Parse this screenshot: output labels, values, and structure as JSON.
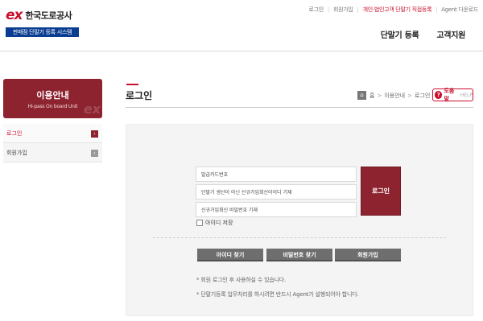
{
  "header": {
    "logo_ex": "ex",
    "logo_name": "한국도로공사",
    "system_badge": "판매점 단말기 등록 시스템",
    "top_links": [
      "로그인",
      "회원가입",
      "개인·법인고객 단말기 직접등록",
      "Agent 다운로드"
    ],
    "main_nav": [
      "단말기 등록",
      "고객지원"
    ]
  },
  "sidebar": {
    "title": "이용안내",
    "subtitle": "Hi-pass On board Unit",
    "items": [
      {
        "label": "로그인",
        "active": true
      },
      {
        "label": "회원가입",
        "active": false
      }
    ]
  },
  "content": {
    "title": "로그인",
    "breadcrumb": [
      "홈",
      "이용안내",
      "로그인"
    ],
    "help_label": "도움말",
    "help_sub": "HELP"
  },
  "login": {
    "fields": [
      "발급카드번호",
      "단말기 생산이 아닌 신규가입희신아이디 기재",
      "신규가입회신 비밀번호 기재"
    ],
    "login_button": "로그인",
    "save_id": "아이디 저장",
    "buttons": [
      "아이디 찾기",
      "비밀번호 찾기",
      "회원가입"
    ],
    "notes": [
      "*  회원 로그인 후 사용하실 수 있습니다.",
      "*  단말기등록 업무처리를 하시려면 반드시 Agent가 설행되어야 합니다."
    ]
  },
  "colors": {
    "brand_red": "#c8102e",
    "burgundy": "#8e2330",
    "navy": "#0a3d91"
  }
}
